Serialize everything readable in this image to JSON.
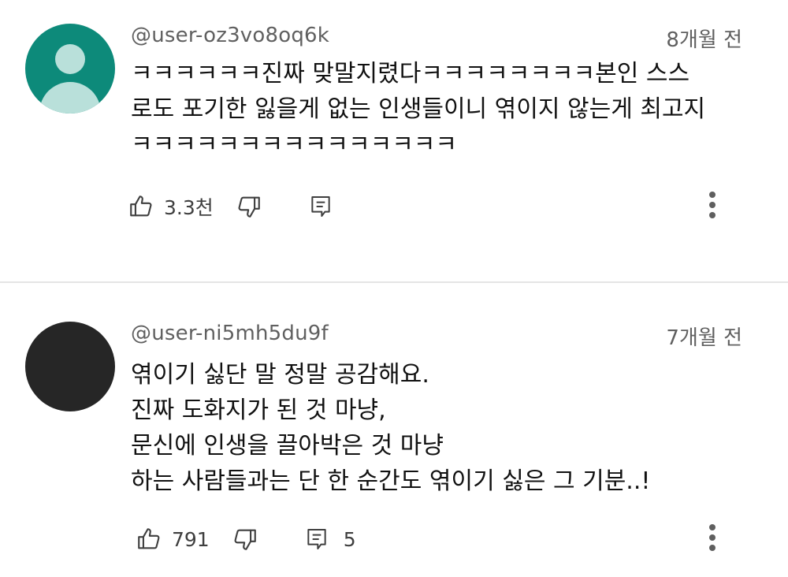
{
  "comments": [
    {
      "handle": "@user-oz3vo8oq6k",
      "time": "8개월 전",
      "avatar_color": "#0d8a7a",
      "lines": [
        "ㅋㅋㅋㅋㅋㅋ진짜 맞말지렸다ㅋㅋㅋㅋㅋㅋㅋㅋ본인 스스",
        "로도 포기한 잃을게 없는 인생들이니 엮이지 않는게 최고지",
        "ㅋㅋㅋㅋㅋㅋㅋㅋㅋㅋㅋㅋㅋㅋㅋ"
      ],
      "likes": "3.3천",
      "replies": ""
    },
    {
      "handle": "@user-ni5mh5du9f",
      "time": "7개월 전",
      "avatar_color": "#262626",
      "lines": [
        "엮이기 싫단 말 정말 공감해요.",
        "진짜 도화지가 된 것 마냥,",
        "문신에 인생을 끌아박은 것 마냥",
        "하는 사람들과는 단 한 순간도 엮이기 싫은 그 기분..!"
      ],
      "likes": "791",
      "replies": "5"
    }
  ],
  "icons": {
    "like": "thumbs-up-icon",
    "dislike": "thumbs-down-icon",
    "reply": "comment-icon",
    "more": "more-vert-icon"
  }
}
